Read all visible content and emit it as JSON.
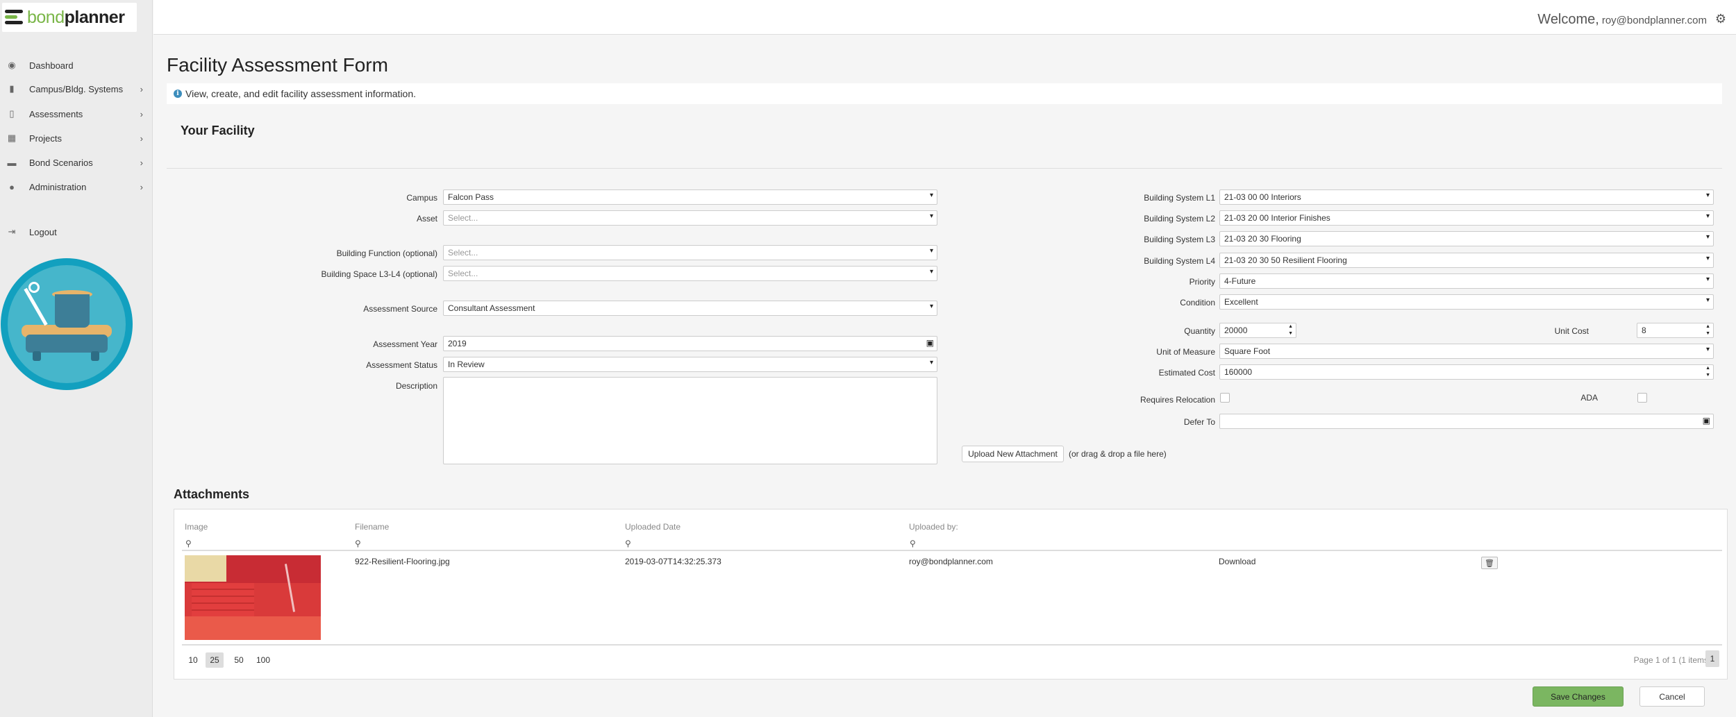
{
  "brand": {
    "part1": "bond",
    "part2": "planner"
  },
  "header": {
    "welcome": "Welcome,",
    "email": "roy@bondplanner.com"
  },
  "sidebar": {
    "items": [
      {
        "label": "Dashboard",
        "icon": "dashboard-icon"
      },
      {
        "label": "Campus/Bldg. Systems",
        "icon": "building-icon"
      },
      {
        "label": "Assessments",
        "icon": "document-icon"
      },
      {
        "label": "Projects",
        "icon": "grid-icon"
      },
      {
        "label": "Bond Scenarios",
        "icon": "briefcase-icon"
      },
      {
        "label": "Administration",
        "icon": "users-icon"
      },
      {
        "label": "Logout",
        "icon": "logout-icon"
      }
    ]
  },
  "page": {
    "title": "Facility Assessment Form",
    "info": "View, create, and edit facility assessment information.",
    "section": "Your Facility"
  },
  "form_left": {
    "campus": {
      "label": "Campus",
      "value": "Falcon Pass"
    },
    "asset": {
      "label": "Asset",
      "placeholder": "Select..."
    },
    "building_function": {
      "label": "Building Function (optional)",
      "placeholder": "Select..."
    },
    "building_space": {
      "label": "Building Space L3-L4 (optional)",
      "placeholder": "Select..."
    },
    "assessment_source": {
      "label": "Assessment Source",
      "value": "Consultant Assessment"
    },
    "assessment_year": {
      "label": "Assessment Year",
      "value": "2019"
    },
    "assessment_status": {
      "label": "Assessment Status",
      "value": "In Review"
    },
    "description": {
      "label": "Description",
      "value": ""
    }
  },
  "form_right": {
    "bs_l1": {
      "label": "Building System L1",
      "value": "21-03 00 00 Interiors"
    },
    "bs_l2": {
      "label": "Building System L2",
      "value": "21-03 20 00 Interior Finishes"
    },
    "bs_l3": {
      "label": "Building System L3",
      "value": "21-03 20 30 Flooring"
    },
    "bs_l4": {
      "label": "Building System L4",
      "value": "21-03 20 30 50 Resilient Flooring"
    },
    "priority": {
      "label": "Priority",
      "value": "4-Future"
    },
    "condition": {
      "label": "Condition",
      "value": "Excellent"
    },
    "quantity": {
      "label": "Quantity",
      "value": "20000"
    },
    "unit_cost": {
      "label": "Unit Cost",
      "value": "8"
    },
    "unit_of_measure": {
      "label": "Unit of Measure",
      "value": "Square Foot"
    },
    "estimated_cost": {
      "label": "Estimated Cost",
      "value": "160000"
    },
    "requires_relocation": {
      "label": "Requires Relocation",
      "checked": false
    },
    "ada": {
      "label": "ADA",
      "checked": false
    },
    "defer_to": {
      "label": "Defer To",
      "value": ""
    }
  },
  "upload": {
    "button": "Upload New Attachment",
    "hint": "(or drag & drop a file here)"
  },
  "attachments": {
    "title": "Attachments",
    "columns": [
      "Image",
      "Filename",
      "Uploaded Date",
      "Uploaded by:"
    ],
    "rows": [
      {
        "filename": "922-Resilient-Flooring.jpg",
        "uploaded_date": "2019-03-07T14:32:25.373",
        "uploaded_by": "roy@bondplanner.com",
        "action": "Download"
      }
    ],
    "page_sizes": [
      "10",
      "25",
      "50",
      "100"
    ],
    "active_page_size": "25",
    "page_info": "Page 1 of 1 (1 items)",
    "current_page": "1"
  },
  "actions": {
    "save": "Save Changes",
    "cancel": "Cancel"
  },
  "colors": {
    "primary_button": "#7bb661",
    "brand_green": "#7ab648",
    "mascot_teal": "#12a0bf"
  }
}
